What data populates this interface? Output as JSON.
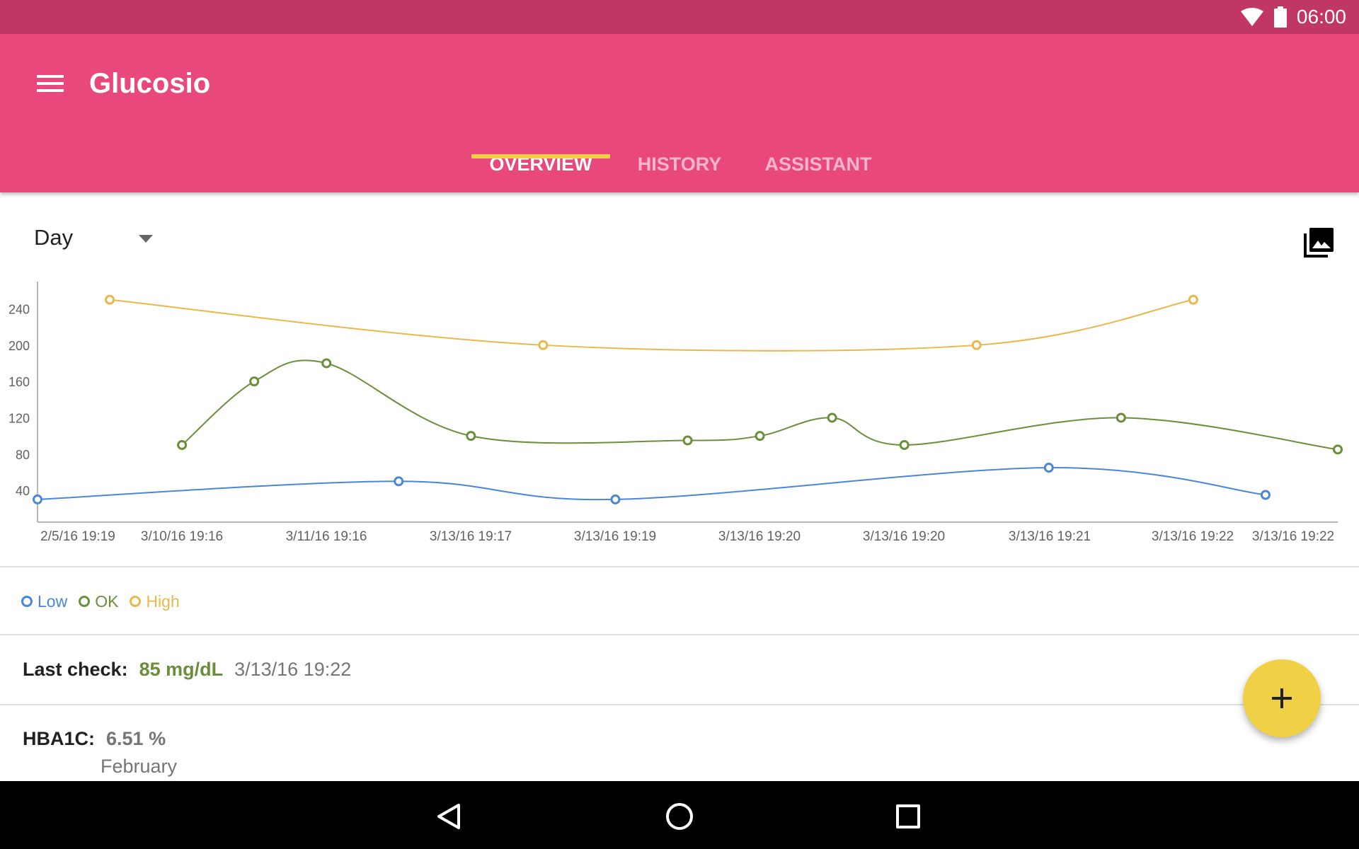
{
  "status_bar": {
    "time": "06:00",
    "icons": [
      "wifi-icon",
      "battery-icon"
    ]
  },
  "app_bar": {
    "title": "Glucosio",
    "menu_icon": "menu-icon"
  },
  "tabs": [
    {
      "label": "OVERVIEW",
      "active": true
    },
    {
      "label": "HISTORY",
      "active": false
    },
    {
      "label": "ASSISTANT",
      "active": false
    }
  ],
  "range_selector": {
    "selected": "Day",
    "arrow_icon": "dropdown-arrow-icon"
  },
  "export_icon": "photo-library-icon",
  "chart_data": {
    "type": "line",
    "categories": [
      "2/5/16 19:19",
      "3/10/16 19:16",
      "3/11/16 19:16",
      "3/13/16 19:17",
      "3/13/16 19:19",
      "3/13/16 19:20",
      "3/13/16 19:20",
      "3/13/16 19:21",
      "3/13/16 19:22",
      "3/13/16 19:22"
    ],
    "y_ticks": [
      40,
      80,
      120,
      160,
      200,
      240
    ],
    "ylim": [
      5,
      270
    ],
    "xlim": [
      0,
      18
    ],
    "grid": false,
    "series": [
      {
        "name": "Low",
        "color": "#4a86d8",
        "points": [
          [
            0,
            30
          ],
          [
            5,
            50
          ],
          [
            8,
            30
          ],
          [
            14,
            65
          ],
          [
            17,
            35
          ]
        ]
      },
      {
        "name": "OK",
        "color": "#6b8e3a",
        "points": [
          [
            2,
            90
          ],
          [
            3,
            160
          ],
          [
            4,
            180
          ],
          [
            6,
            100
          ],
          [
            9,
            95
          ],
          [
            10,
            100
          ],
          [
            11,
            120
          ],
          [
            12,
            90
          ],
          [
            15,
            120
          ],
          [
            18,
            85
          ]
        ]
      },
      {
        "name": "High",
        "color": "#e8b84a",
        "points": [
          [
            1,
            250
          ],
          [
            7,
            200
          ],
          [
            13,
            200
          ],
          [
            16,
            250
          ]
        ]
      }
    ]
  },
  "legend": [
    {
      "label": "Low",
      "color": "#4a86d8"
    },
    {
      "label": "OK",
      "color": "#6b8e3a"
    },
    {
      "label": "High",
      "color": "#e8b84a"
    }
  ],
  "last_check": {
    "label": "Last check:",
    "value": "85 mg/dL",
    "time": "3/13/16 19:22"
  },
  "hba1c": {
    "label": "HBA1C:",
    "value": "6.51 %",
    "month": "February"
  },
  "fab": {
    "label": "+",
    "icon": "add-icon"
  },
  "nav_bar": {
    "icons": [
      "back-icon",
      "home-icon",
      "recents-icon"
    ]
  },
  "colors": {
    "primary": "#e8497a",
    "primary_dark": "#c13763",
    "accent": "#f0d145"
  }
}
